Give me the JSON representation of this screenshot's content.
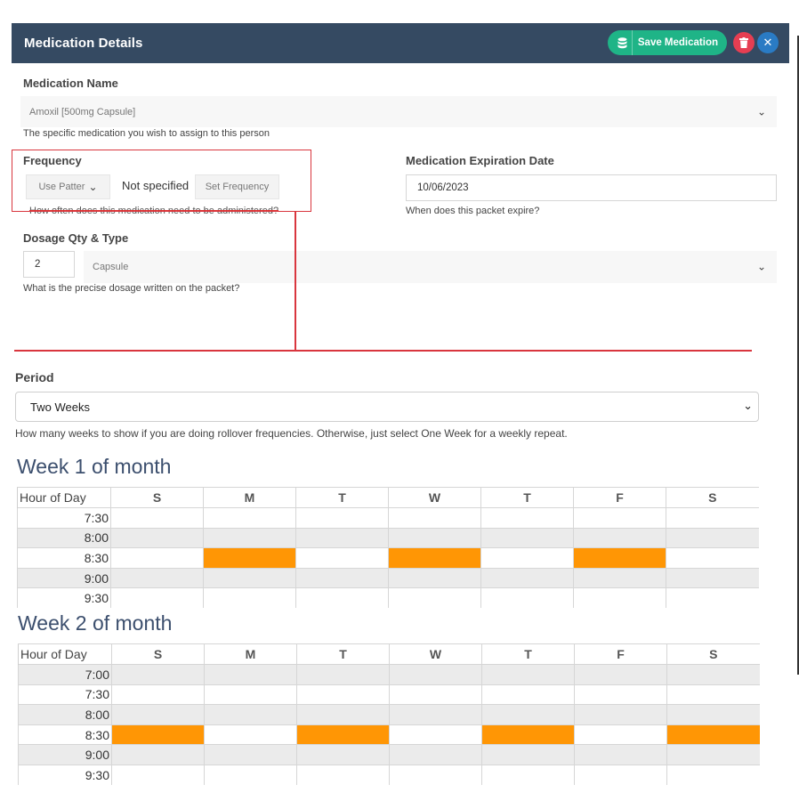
{
  "modal": {
    "title": "Medication Details",
    "save_label": "Save Medication",
    "icons": [
      "database-icon",
      "trash-icon",
      "close-icon"
    ]
  },
  "medication": {
    "label": "Medication Name",
    "value": "Amoxil [500mg Capsule]",
    "help": "The specific medication you wish to assign to this person"
  },
  "frequency": {
    "label": "Frequency",
    "pattern_button": "Use Patter",
    "status": "Not specified",
    "set_button": "Set Frequency",
    "help": "How often does this medication need to be administered?"
  },
  "expiration": {
    "label": "Medication Expiration Date",
    "value": "10/06/2023",
    "help": "When does this packet expire?"
  },
  "dosage": {
    "label": "Dosage Qty & Type",
    "qty": "2",
    "type": "Capsule",
    "help": "What is the precise dosage written on the packet?"
  },
  "period": {
    "label": "Period",
    "value": "Two Weeks",
    "help": "How many weeks to show if you are doing rollover frequencies. Otherwise, just select One Week for a weekly repeat."
  },
  "days": [
    "S",
    "M",
    "T",
    "W",
    "T",
    "F",
    "S"
  ],
  "hour_header": "Hour of Day",
  "weeks": [
    {
      "title": "Week 1 of month",
      "rows": [
        {
          "time": "7:30",
          "on": [
            false,
            false,
            false,
            false,
            false,
            false,
            false
          ]
        },
        {
          "time": "8:00",
          "on": [
            false,
            false,
            false,
            false,
            false,
            false,
            false
          ]
        },
        {
          "time": "8:30",
          "on": [
            false,
            true,
            false,
            true,
            false,
            true,
            false
          ]
        },
        {
          "time": "9:00",
          "on": [
            false,
            false,
            false,
            false,
            false,
            false,
            false
          ]
        },
        {
          "time": "9:30",
          "on": [
            false,
            false,
            false,
            false,
            false,
            false,
            false
          ]
        }
      ]
    },
    {
      "title": "Week 2 of month",
      "rows": [
        {
          "time": "7:00",
          "on": [
            false,
            false,
            false,
            false,
            false,
            false,
            false
          ]
        },
        {
          "time": "7:30",
          "on": [
            false,
            false,
            false,
            false,
            false,
            false,
            false
          ]
        },
        {
          "time": "8:00",
          "on": [
            false,
            false,
            false,
            false,
            false,
            false,
            false
          ]
        },
        {
          "time": "8:30",
          "on": [
            true,
            false,
            true,
            false,
            true,
            false,
            true
          ]
        },
        {
          "time": "9:00",
          "on": [
            false,
            false,
            false,
            false,
            false,
            false,
            false
          ]
        },
        {
          "time": "9:30",
          "on": [
            false,
            false,
            false,
            false,
            false,
            false,
            false
          ]
        }
      ]
    }
  ],
  "colors": {
    "header_bg": "#354a62",
    "save_green": "#1fb487",
    "delete_red": "#e63e52",
    "close_blue": "#2a7bc4",
    "selected_cell": "#ff9605",
    "annotation_red": "#d9363e"
  }
}
